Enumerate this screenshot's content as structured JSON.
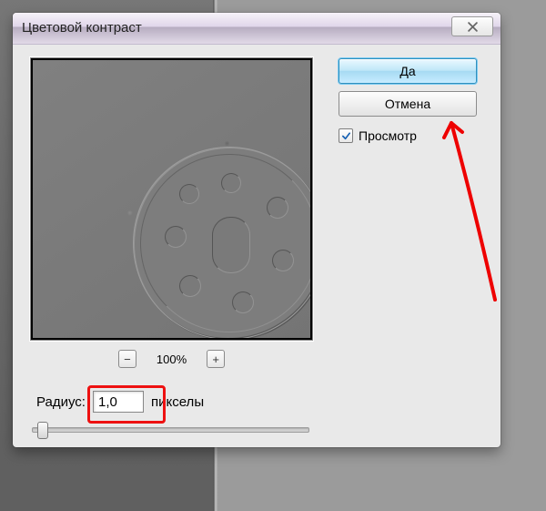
{
  "dialog": {
    "title": "Цветовой контраст",
    "close_symbol": "✕"
  },
  "zoom": {
    "minus": "−",
    "plus": "+",
    "level": "100%"
  },
  "radius": {
    "label": "Радиус:",
    "value": "1,0",
    "unit": "пикселы"
  },
  "buttons": {
    "ok": "Да",
    "cancel": "Отмена"
  },
  "preview_checkbox": {
    "label": "Просмотр",
    "checked": true
  },
  "annotations": {
    "arrow_color": "#e11",
    "highlight_color": "#e11"
  }
}
